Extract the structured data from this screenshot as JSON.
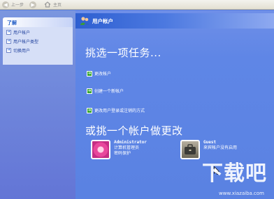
{
  "navbar": {
    "back_label": "上一步",
    "home_label": "主页"
  },
  "sidebar": {
    "header": "了解",
    "items": [
      {
        "label": "用户帐户",
        "icon": "arrow-icon"
      },
      {
        "label": "用户帐户类型",
        "icon": "arrow-icon"
      },
      {
        "label": "切换用户",
        "icon": "arrow-icon"
      }
    ]
  },
  "main": {
    "title": "用户帐户",
    "pick_task": "挑选一项任务...",
    "tasks": [
      {
        "label": "更改帐户"
      },
      {
        "label": "创建一个新帐户"
      },
      {
        "label": "更改用户登录或注销的方式"
      }
    ],
    "pick_account": "或挑一个帐户做更改",
    "accounts": [
      {
        "name": "Administrator",
        "lines": [
          "计算机管理员",
          "密码保护"
        ],
        "icon": "flower-avatar-icon"
      },
      {
        "name": "Guest",
        "lines": [
          "来宾帐户没有启用"
        ],
        "icon": "briefcase-avatar-icon"
      }
    ]
  },
  "watermark": {
    "text": "下载吧",
    "url": "www.xiazaiba.com"
  },
  "colors": {
    "main_bg": "#5a82e2",
    "header_blue": "#2e5fd1",
    "sidebar_box": "#d6dff7",
    "task_green": "#3aa630"
  }
}
